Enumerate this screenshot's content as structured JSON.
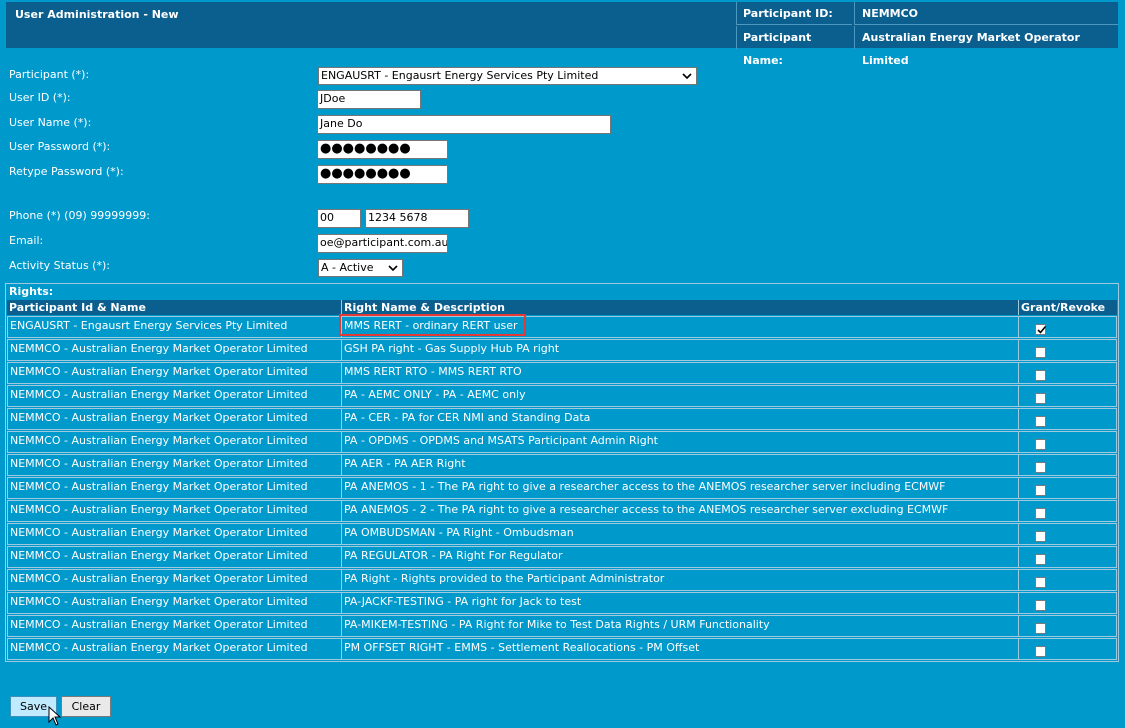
{
  "header": {
    "title": "User Administration - New",
    "participant_id_label": "Participant ID:",
    "participant_id_value": "NEMMCO",
    "participant_name_label": "Participant Name:",
    "participant_name_value": "Australian Energy Market Operator Limited"
  },
  "form": {
    "participant_label": "Participant (*):",
    "participant_value": "ENGAUSRT - Engausrt Energy Services Pty Limited",
    "user_id_label": "User ID (*):",
    "user_id_value": "JDoe",
    "user_name_label": "User Name (*):",
    "user_name_value": "Jane Do",
    "password_label": "User Password (*):",
    "password_mask": "●●●●●●●●",
    "retype_label": "Retype Password (*):",
    "retype_mask": "●●●●●●●●",
    "phone_label": "Phone (*) (09) 99999999:",
    "phone_area": "00",
    "phone_number": "1234 5678",
    "email_label": "Email:",
    "email_value": "oe@participant.com.au",
    "status_label": "Activity Status (*):",
    "status_value": "A - Active"
  },
  "rights": {
    "title": "Rights:",
    "col_participant": "Participant Id & Name",
    "col_right": "Right Name & Description",
    "col_grant": "Grant/Revoke",
    "rows": [
      {
        "participant": "ENGAUSRT - Engausrt Energy Services Pty Limited",
        "right": "MMS RERT -  ordinary RERT user",
        "checked": true
      },
      {
        "participant": "NEMMCO - Australian Energy Market Operator Limited",
        "right": "GSH PA right - Gas Supply Hub PA right",
        "checked": false
      },
      {
        "participant": "NEMMCO - Australian Energy Market Operator Limited",
        "right": "MMS RERT RTO - MMS RERT RTO",
        "checked": false
      },
      {
        "participant": "NEMMCO - Australian Energy Market Operator Limited",
        "right": "PA - AEMC ONLY - PA - AEMC only",
        "checked": false
      },
      {
        "participant": "NEMMCO - Australian Energy Market Operator Limited",
        "right": "PA - CER - PA for CER NMI and Standing Data",
        "checked": false
      },
      {
        "participant": "NEMMCO - Australian Energy Market Operator Limited",
        "right": "PA - OPDMS - OPDMS and MSATS Participant Admin Right",
        "checked": false
      },
      {
        "participant": "NEMMCO - Australian Energy Market Operator Limited",
        "right": "PA AER - PA AER Right",
        "checked": false
      },
      {
        "participant": "NEMMCO - Australian Energy Market Operator Limited",
        "right": "PA ANEMOS - 1 - The PA right to give a researcher access to the ANEMOS researcher server including ECMWF",
        "checked": false
      },
      {
        "participant": "NEMMCO - Australian Energy Market Operator Limited",
        "right": "PA ANEMOS - 2 - The PA right to give a researcher access to the ANEMOS researcher server excluding ECMWF",
        "checked": false
      },
      {
        "participant": "NEMMCO - Australian Energy Market Operator Limited",
        "right": "PA OMBUDSMAN - PA Right - Ombudsman",
        "checked": false
      },
      {
        "participant": "NEMMCO - Australian Energy Market Operator Limited",
        "right": "PA REGULATOR - PA Right For Regulator",
        "checked": false
      },
      {
        "participant": "NEMMCO - Australian Energy Market Operator Limited",
        "right": "PA Right - Rights provided to the Participant Administrator",
        "checked": false
      },
      {
        "participant": "NEMMCO - Australian Energy Market Operator Limited",
        "right": "PA-JACKF-TESTING - PA right for Jack to test",
        "checked": false
      },
      {
        "participant": "NEMMCO - Australian Energy Market Operator Limited",
        "right": "PA-MIKEM-TESTING - PA Right for Mike to Test Data Rights / URM Functionality",
        "checked": false
      },
      {
        "participant": "NEMMCO - Australian Energy Market Operator Limited",
        "right": "PM OFFSET RIGHT - EMMS - Settlement Reallocations - PM Offset",
        "checked": false
      }
    ]
  },
  "buttons": {
    "save": "Save",
    "clear": "Clear"
  },
  "colors": {
    "page_bg": "#0099cc",
    "header_bg": "#0a5f8f",
    "highlight": "#e53935"
  }
}
